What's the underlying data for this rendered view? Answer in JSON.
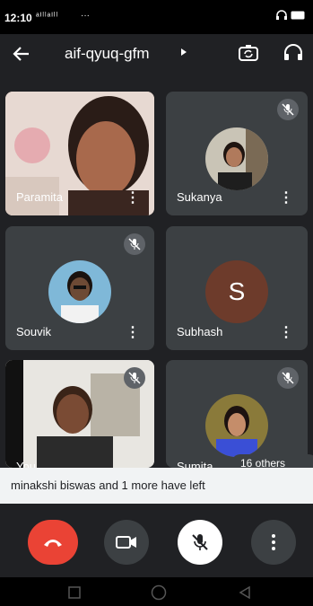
{
  "status": {
    "time": "12:10",
    "signal": "ᵃᴵˡˡᵃᴵˡˡ",
    "more": "···"
  },
  "header": {
    "meeting_code": "aif-qyuq-gfm"
  },
  "participants": [
    {
      "name": "Paramita",
      "muted": false
    },
    {
      "name": "Sukanya",
      "muted": true
    },
    {
      "name": "Souvik",
      "muted": true
    },
    {
      "name": "Subhash",
      "muted": false,
      "initial": "S"
    },
    {
      "name": "You",
      "muted": true
    },
    {
      "name": "Sumita",
      "muted": true
    }
  ],
  "others_pill": "16 others",
  "toast": "minakshi biswas and 1 more have left",
  "colors": {
    "end_call": "#ea4335",
    "tile": "#3c4043",
    "background": "#202124",
    "subhash_avatar": "#6d3b2b"
  }
}
